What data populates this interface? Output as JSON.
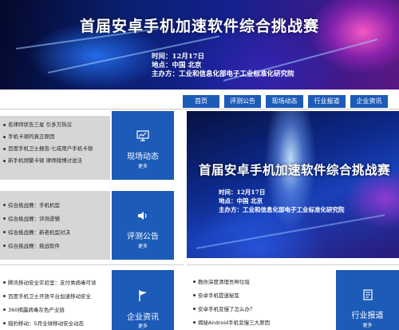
{
  "banner": {
    "title": "首届安卓手机加速软件综合挑战赛",
    "time": "时间：12月17日",
    "location": "地点：中国 北京",
    "organizer": "主办方：工业和信息化部电子工业标准化研究院"
  },
  "nav": {
    "items": [
      {
        "label": "首页"
      },
      {
        "label": "评测公告"
      },
      {
        "label": "现场动态"
      },
      {
        "label": "行业报道"
      },
      {
        "label": "企业资讯"
      }
    ]
  },
  "live_news": {
    "items": [
      "名律师状告三星 引多方热议",
      "手机卡顿的真正原因",
      "百度手机卫士报告:七成用户手机卡顿",
      "新手机频繁卡顿 律师微博讨说法"
    ],
    "category": {
      "title": "现场动态",
      "more": "更多",
      "icon": "monitor-icon"
    }
  },
  "review_news": {
    "items": [
      "综合挑战赛：手机机型",
      "综合挑战赛：评测逻辑",
      "综合挑战赛：新老机型对决",
      "综合挑战赛：挑战软件"
    ],
    "category": {
      "title": "评测公告",
      "more": "更多",
      "icon": "speaker-icon"
    }
  },
  "company_news": {
    "items": [
      "腾讯移动安全实验室：支付类病毒可读",
      "百度手机卫士开放平台加速移动安全",
      "360揭露病毒灰色产业链",
      "猎豹移动：5月全球移动安全动态"
    ],
    "category": {
      "title": "企业资讯",
      "more": "更多",
      "icon": "flag-icon"
    }
  },
  "industry_news": {
    "items": [
      "教你深度清理吾种垃圾",
      "安卓手机提速秘笈",
      "安卓手机变慢了怎么办？",
      "揭秘Android手机变慢三大原因"
    ],
    "category": {
      "title": "行业报道",
      "more": "更多",
      "icon": "document-icon"
    }
  },
  "feature": {
    "title": "首届安卓手机加速软件综合挑战赛",
    "time": "时间：12月17日",
    "location": "地点：中国 北京",
    "organizer": "主办方：工业和信息化部电子工业标准化研究院"
  },
  "colors": {
    "accent": "#1c5bb8",
    "panel_gray": "#d6d6d6"
  }
}
